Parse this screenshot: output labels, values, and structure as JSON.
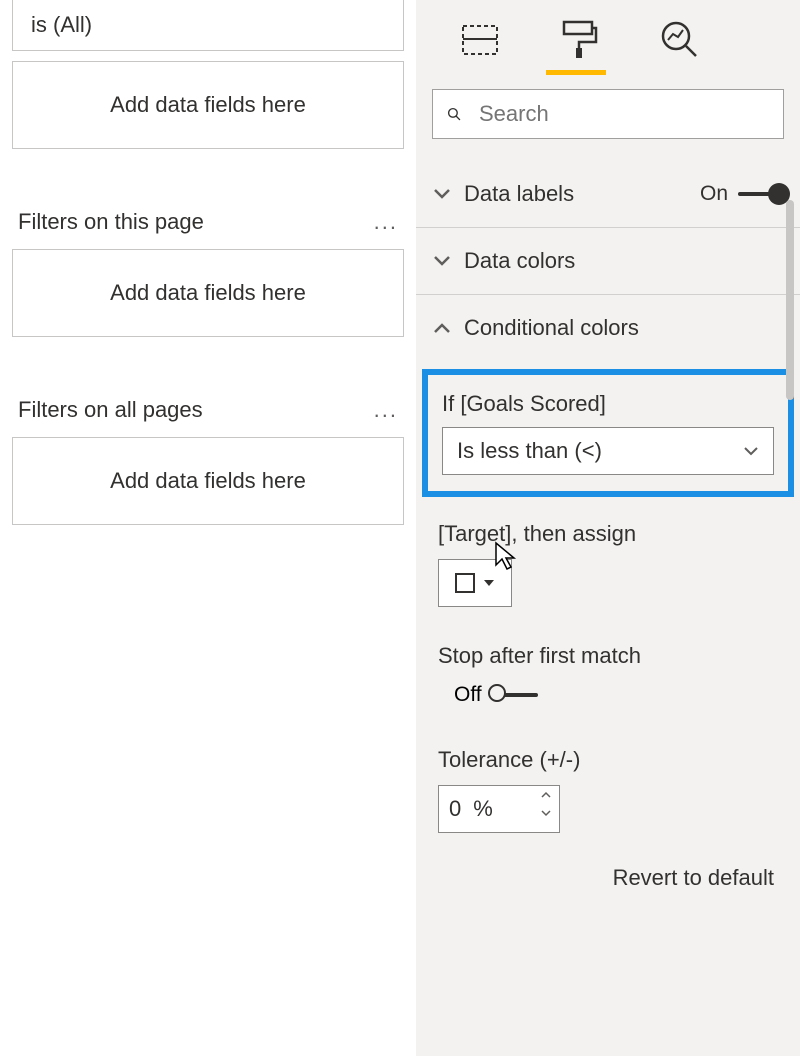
{
  "filters": {
    "current_filter_text": "is (All)",
    "add_placeholder": "Add data fields here",
    "this_page_title": "Filters on this page",
    "all_pages_title": "Filters on all pages"
  },
  "tabs": {
    "fields_icon": "fields",
    "format_icon": "paint-roller",
    "analytics_icon": "magnifier-chart"
  },
  "search": {
    "placeholder": "Search"
  },
  "props": {
    "data_labels": {
      "label": "Data labels",
      "state": "On"
    },
    "data_colors": {
      "label": "Data colors"
    },
    "conditional_colors": {
      "label": "Conditional colors"
    }
  },
  "conditional": {
    "if_label": "If [Goals Scored]",
    "if_value": "Is less than (<)",
    "target_label": "[Target], then assign",
    "stop_label": "Stop after first match",
    "stop_state": "Off",
    "tolerance_label": "Tolerance (+/-)",
    "tolerance_value": "0",
    "tolerance_unit": "%"
  },
  "revert_label": "Revert to default"
}
